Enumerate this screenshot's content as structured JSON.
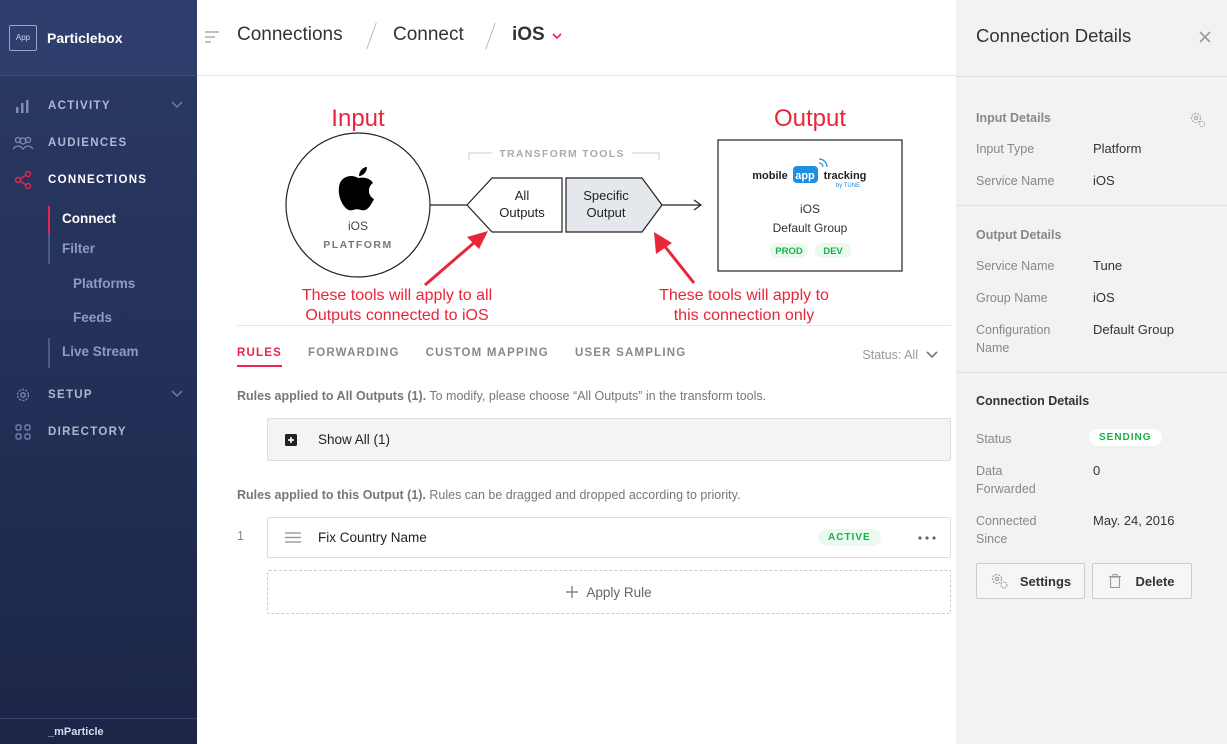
{
  "app": {
    "logo_text": "App",
    "name": "Particlebox"
  },
  "sidebar": {
    "items": [
      {
        "label": "ACTIVITY"
      },
      {
        "label": "AUDIENCES"
      },
      {
        "label": "CONNECTIONS"
      },
      {
        "label": "SETUP"
      },
      {
        "label": "DIRECTORY"
      }
    ],
    "sub": [
      "Connect",
      "Filter",
      "Platforms",
      "Feeds",
      "Live Stream"
    ],
    "footer": "_mParticle"
  },
  "breadcrumb": {
    "items": [
      "Connections",
      "Connect",
      "iOS"
    ]
  },
  "diagram": {
    "input_heading": "Input",
    "output_heading": "Output",
    "input_name": "iOS",
    "input_type": "PLATFORM",
    "transform_label": "TRANSFORM TOOLS",
    "all_outputs": [
      "All",
      "Outputs"
    ],
    "specific_output": [
      "Specific",
      "Output"
    ],
    "output_logo": {
      "left": "mobile",
      "mid": "app",
      "right": "tracking",
      "by": "by TUNE"
    },
    "output_name": "iOS",
    "output_group": "Default Group",
    "env_prod": "PROD",
    "env_dev": "DEV",
    "note_left": [
      "These tools will apply to all",
      "Outputs connected to iOS"
    ],
    "note_right": [
      "These tools will apply to",
      "this connection only"
    ]
  },
  "tabs": [
    "RULES",
    "FORWARDING",
    "CUSTOM MAPPING",
    "USER SAMPLING"
  ],
  "status_filter": "Status: All",
  "rules": {
    "all_hint_bold": "Rules applied to All Outputs (1).",
    "all_hint": " To modify, please choose “All Outputs” in the transform tools.",
    "show_all": "Show All (1)",
    "this_hint_bold": "Rules applied to this Output (1).",
    "this_hint": " Rules can be dragged and dropped according to priority.",
    "rule_index": "1",
    "rule_name": "Fix Country Name",
    "rule_status": "ACTIVE",
    "apply_rule": "Apply Rule"
  },
  "panel": {
    "title": "Connection Details",
    "input_section": "Input Details",
    "input_type_label": "Input Type",
    "input_type": "Platform",
    "service_name_label": "Service Name",
    "service_name": "iOS",
    "output_section": "Output Details",
    "out_service_label": "Service Name",
    "out_service": "Tune",
    "group_label": "Group Name",
    "group": "iOS",
    "config_label": "Configuration Name",
    "config": "Default Group",
    "conn_section": "Connection Details",
    "status_label": "Status",
    "status": "SENDING",
    "data_label": "Data Forwarded",
    "data": "0",
    "since_label": "Connected Since",
    "since": "May. 24, 2016",
    "settings_btn": "Settings",
    "delete_btn": "Delete"
  },
  "colors": {
    "accent": "#e8264d",
    "sidebar": "#25325a",
    "success": "#19b04a",
    "annotation": "#e8263a"
  }
}
